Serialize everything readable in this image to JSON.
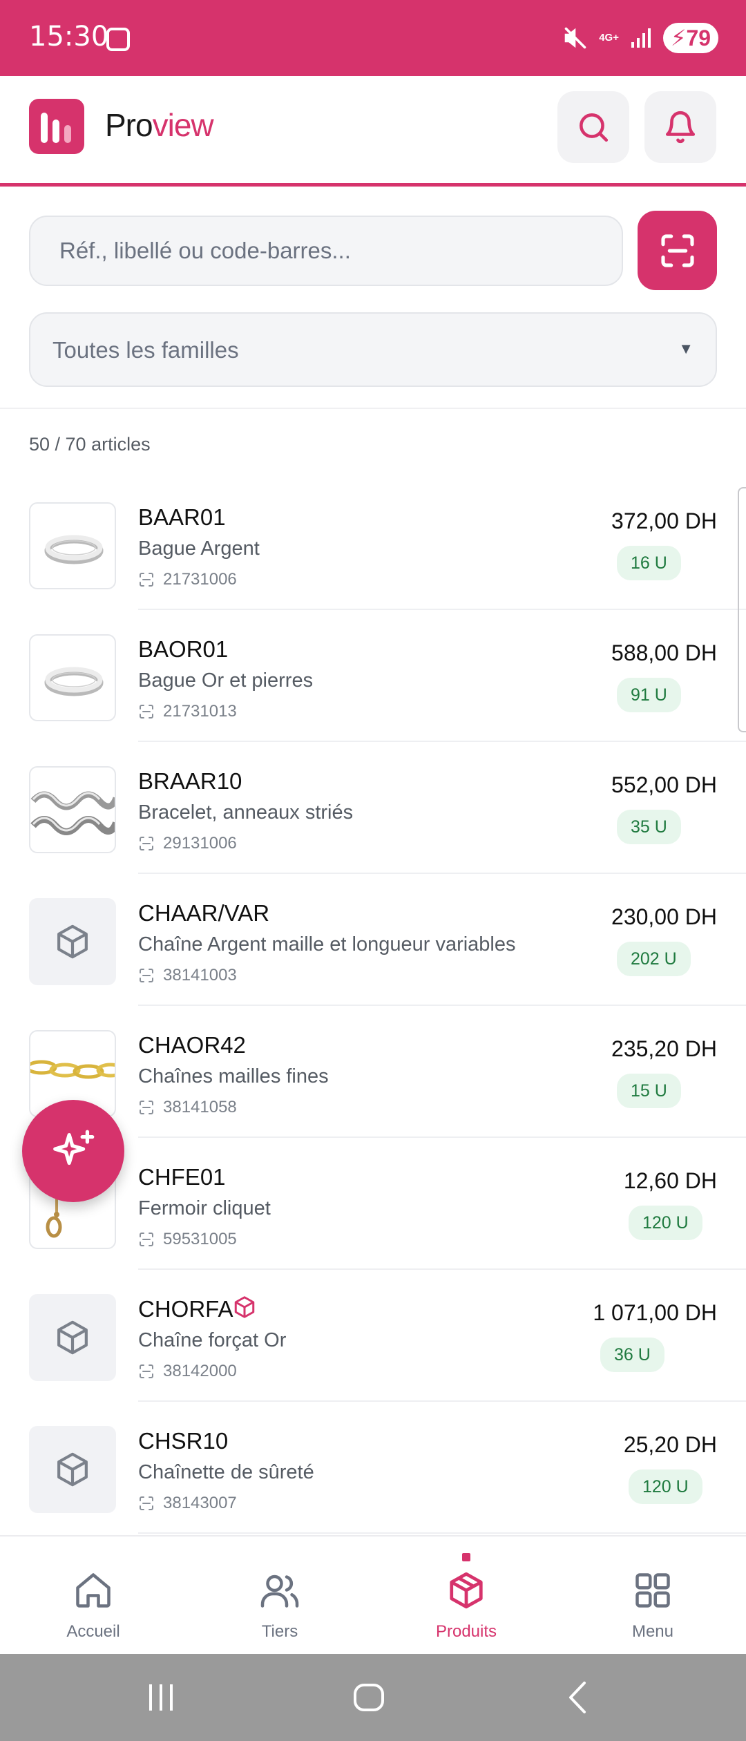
{
  "status_bar": {
    "time": "15:30",
    "network": "4G+",
    "battery": "79"
  },
  "header": {
    "title_part1": "Pro",
    "title_part2": "view"
  },
  "search": {
    "placeholder": "Réf., libellé ou code-barres..."
  },
  "filter": {
    "family_label": "Toutes les familles"
  },
  "list_count": "50 / 70 articles",
  "products": [
    {
      "ref": "BAAR01",
      "desc": "Bague Argent",
      "code": "21731006",
      "price": "372,00 DH",
      "stock": "16 U",
      "image": "ring"
    },
    {
      "ref": "BAOR01",
      "desc": "Bague Or et pierres",
      "code": "21731013",
      "price": "588,00 DH",
      "stock": "91 U",
      "image": "ring"
    },
    {
      "ref": "BRAAR10",
      "desc": "Bracelet, anneaux striés",
      "code": "29131006",
      "price": "552,00 DH",
      "stock": "35 U",
      "image": "bracelet"
    },
    {
      "ref": "CHAAR/VAR",
      "desc": "Chaîne Argent maille et longueur variables",
      "code": "38141003",
      "price": "230,00 DH",
      "stock": "202 U",
      "image": "placeholder"
    },
    {
      "ref": "CHAOR42",
      "desc": "Chaînes mailles fines",
      "code": "38141058",
      "price": "235,20 DH",
      "stock": "15 U",
      "image": "gold-chain"
    },
    {
      "ref": "CHFE01",
      "desc": "Fermoir cliquet",
      "code": "59531005",
      "price": "12,60 DH",
      "stock": "120 U",
      "image": "clasp"
    },
    {
      "ref": "CHORFA",
      "desc": "Chaîne forçat Or",
      "code": "38142000",
      "price": "1 071,00 DH",
      "stock": "36 U",
      "image": "placeholder",
      "badge": "package-icon"
    },
    {
      "ref": "CHSR10",
      "desc": "Chaînette de sûreté",
      "code": "38143007",
      "price": "25,20 DH",
      "stock": "120 U",
      "image": "placeholder"
    }
  ],
  "bottom_nav": [
    {
      "label": "Accueil",
      "icon": "home-icon"
    },
    {
      "label": "Tiers",
      "icon": "users-icon"
    },
    {
      "label": "Produits",
      "icon": "package-icon",
      "active": true
    },
    {
      "label": "Menu",
      "icon": "grid-icon"
    }
  ],
  "colors": {
    "accent": "#d6336c",
    "stock_bg": "#e7f6ec",
    "stock_text": "#1f7a3f"
  }
}
